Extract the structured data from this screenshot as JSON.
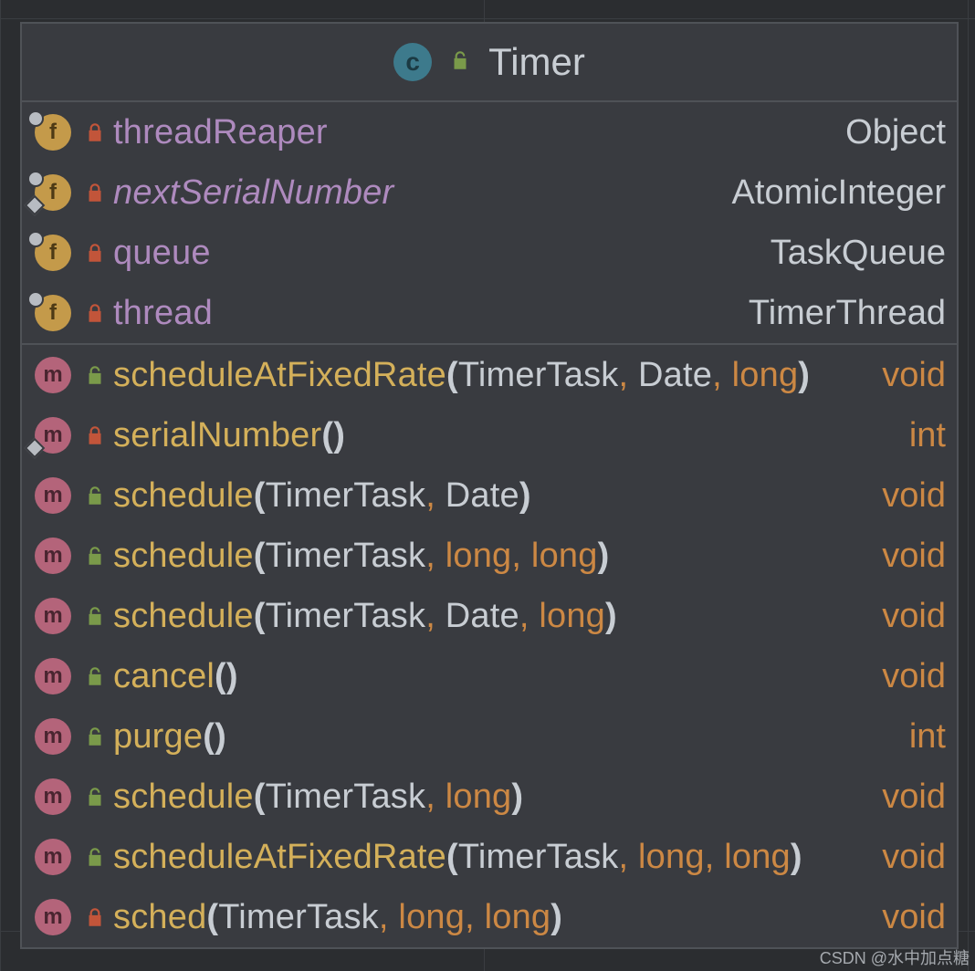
{
  "header": {
    "icon_letter": "c",
    "title": "Timer",
    "access": "public"
  },
  "icons": {
    "field_letter": "f",
    "method_letter": "m"
  },
  "fields": [
    {
      "name": "threadReaper",
      "type": "Object",
      "access": "private",
      "italic": false,
      "pin": true,
      "diamond": false
    },
    {
      "name": "nextSerialNumber",
      "type": "AtomicInteger",
      "access": "private",
      "italic": true,
      "pin": true,
      "diamond": true
    },
    {
      "name": "queue",
      "type": "TaskQueue",
      "access": "private",
      "italic": false,
      "pin": true,
      "diamond": false
    },
    {
      "name": "thread",
      "type": "TimerThread",
      "access": "private",
      "italic": false,
      "pin": true,
      "diamond": false
    }
  ],
  "methods": [
    {
      "name": "scheduleAtFixedRate",
      "params": [
        {
          "t": "TimerTask",
          "kw": false
        },
        {
          "t": "Date",
          "kw": false
        },
        {
          "t": "long",
          "kw": true
        }
      ],
      "ret": "void",
      "retIsKw": true,
      "access": "public",
      "diamond": false
    },
    {
      "name": "serialNumber",
      "params": [],
      "ret": "int",
      "retIsKw": true,
      "access": "private",
      "diamond": true
    },
    {
      "name": "schedule",
      "params": [
        {
          "t": "TimerTask",
          "kw": false
        },
        {
          "t": "Date",
          "kw": false
        }
      ],
      "ret": "void",
      "retIsKw": true,
      "access": "public",
      "diamond": false
    },
    {
      "name": "schedule",
      "params": [
        {
          "t": "TimerTask",
          "kw": false
        },
        {
          "t": "long",
          "kw": true
        },
        {
          "t": "long",
          "kw": true
        }
      ],
      "ret": "void",
      "retIsKw": true,
      "access": "public",
      "diamond": false
    },
    {
      "name": "schedule",
      "params": [
        {
          "t": "TimerTask",
          "kw": false
        },
        {
          "t": "Date",
          "kw": false
        },
        {
          "t": "long",
          "kw": true
        }
      ],
      "ret": "void",
      "retIsKw": true,
      "access": "public",
      "diamond": false
    },
    {
      "name": "cancel",
      "params": [],
      "ret": "void",
      "retIsKw": true,
      "access": "public",
      "diamond": false
    },
    {
      "name": "purge",
      "params": [],
      "ret": "int",
      "retIsKw": true,
      "access": "public",
      "diamond": false
    },
    {
      "name": "schedule",
      "params": [
        {
          "t": "TimerTask",
          "kw": false
        },
        {
          "t": "long",
          "kw": true
        }
      ],
      "ret": "void",
      "retIsKw": true,
      "access": "public",
      "diamond": false
    },
    {
      "name": "scheduleAtFixedRate",
      "params": [
        {
          "t": "TimerTask",
          "kw": false
        },
        {
          "t": "long",
          "kw": true
        },
        {
          "t": "long",
          "kw": true
        }
      ],
      "ret": "void",
      "retIsKw": true,
      "access": "public",
      "diamond": false
    },
    {
      "name": "sched",
      "params": [
        {
          "t": "TimerTask",
          "kw": false
        },
        {
          "t": "long",
          "kw": true
        },
        {
          "t": "long",
          "kw": true
        }
      ],
      "ret": "void",
      "retIsKw": true,
      "access": "private",
      "diamond": false
    }
  ],
  "watermark": "CSDN @水中加点糖"
}
